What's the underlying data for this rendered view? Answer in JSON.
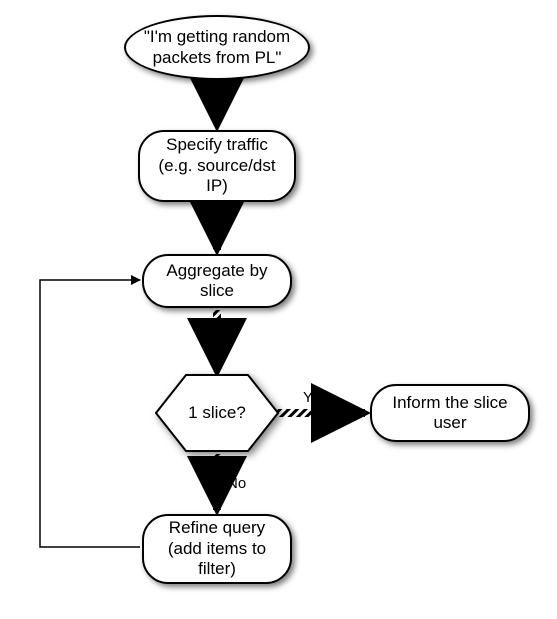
{
  "flow": {
    "start": "\"I'm getting random packets from PL\"",
    "specify": "Specify traffic (e.g. source/dst IP)",
    "aggregate": "Aggregate by slice",
    "decision": "1 slice?",
    "inform": "Inform the slice user",
    "refine": "Refine query (add items to filter)",
    "yes": "Yes",
    "no": "No"
  },
  "chart_data": {
    "type": "flowchart",
    "nodes": [
      {
        "id": "start",
        "shape": "ellipse",
        "text": "\"I'm getting random packets from PL\""
      },
      {
        "id": "specify",
        "shape": "rounded-rect",
        "text": "Specify traffic (e.g. source/dst IP)"
      },
      {
        "id": "aggregate",
        "shape": "rounded-rect",
        "text": "Aggregate by slice"
      },
      {
        "id": "decision",
        "shape": "hexagon",
        "text": "1 slice?"
      },
      {
        "id": "inform",
        "shape": "rounded-rect",
        "text": "Inform the slice user"
      },
      {
        "id": "refine",
        "shape": "rounded-rect",
        "text": "Refine query (add items to filter)"
      }
    ],
    "edges": [
      {
        "from": "start",
        "to": "specify",
        "style": "hatched"
      },
      {
        "from": "specify",
        "to": "aggregate",
        "style": "hatched"
      },
      {
        "from": "aggregate",
        "to": "decision",
        "style": "hatched"
      },
      {
        "from": "decision",
        "to": "inform",
        "label": "Yes",
        "style": "hatched"
      },
      {
        "from": "decision",
        "to": "refine",
        "label": "No",
        "style": "hatched"
      },
      {
        "from": "refine",
        "to": "aggregate",
        "style": "solid"
      }
    ]
  }
}
